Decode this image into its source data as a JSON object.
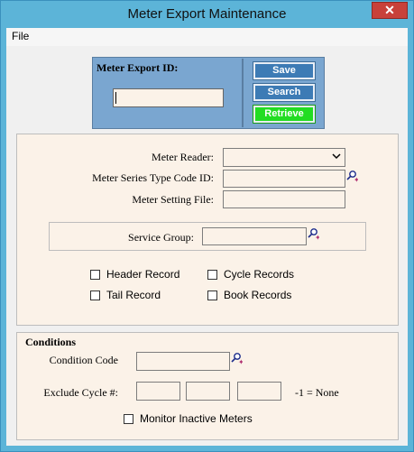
{
  "window": {
    "title": "Meter Export Maintenance",
    "close_glyph": "✕"
  },
  "menu": {
    "file": "File"
  },
  "id_panel": {
    "label": "Meter Export ID:",
    "value": "",
    "buttons": {
      "save": "Save",
      "search": "Search",
      "retrieve": "Retrieve"
    }
  },
  "main": {
    "meter_reader_label": "Meter Reader:",
    "meter_reader_value": "",
    "meter_series_label": "Meter Series Type Code ID:",
    "meter_setting_label": "Meter Setting File:",
    "service_group_label": "Service Group:",
    "checkboxes": {
      "header_record": "Header Record",
      "cycle_records": "Cycle Records",
      "tail_record": "Tail Record",
      "book_records": "Book Records"
    }
  },
  "conditions": {
    "title": "Conditions",
    "condition_code_label": "Condition Code",
    "exclude_cycle_label": "Exclude Cycle #:",
    "exclude_note": "-1 = None",
    "monitor_inactive": "Monitor Inactive Meters"
  },
  "colors": {
    "titlebar": "#5cb4d8",
    "panel": "#fbf2e8",
    "id_panel": "#7aa6d0",
    "button_blue": "#3d7bb5",
    "button_green": "#22dd22",
    "close": "#c8413a"
  },
  "icons": {
    "lookup": "magnifier-sparkle-icon",
    "dropdown": "chevron-down-icon"
  }
}
